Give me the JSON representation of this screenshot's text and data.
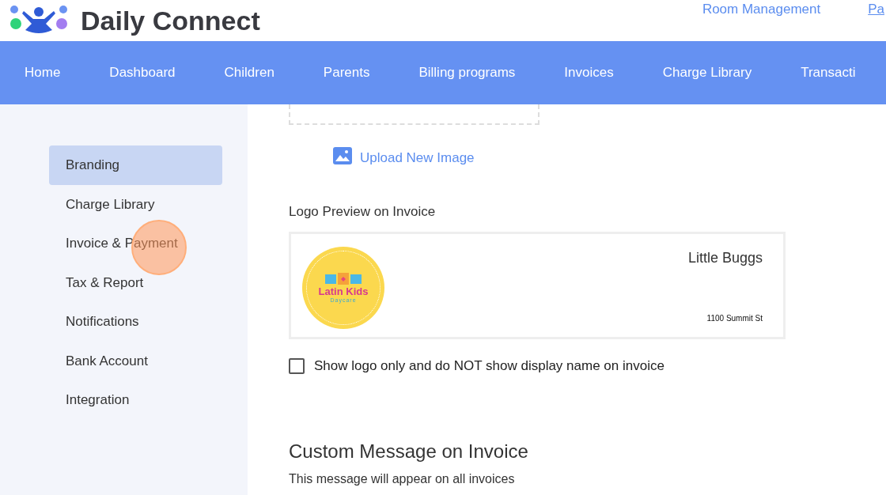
{
  "header": {
    "app_name": "Daily Connect",
    "links": [
      "Room Management",
      "Pa"
    ]
  },
  "nav": [
    "Home",
    "Dashboard",
    "Children",
    "Parents",
    "Billing programs",
    "Invoices",
    "Charge Library",
    "Transacti"
  ],
  "sidebar": {
    "items": [
      {
        "label": "Branding",
        "selected": true
      },
      {
        "label": "Charge Library",
        "selected": false
      },
      {
        "label": "Invoice & Payment",
        "selected": false
      },
      {
        "label": "Tax & Report",
        "selected": false
      },
      {
        "label": "Notifications",
        "selected": false
      },
      {
        "label": "Bank Account",
        "selected": false
      },
      {
        "label": "Integration",
        "selected": false
      }
    ]
  },
  "upload": {
    "label": "Upload New Image"
  },
  "logo_preview": {
    "heading": "Logo Preview on Invoice",
    "logo_title": "Latin Kids",
    "logo_subtitle": "Daycare",
    "display_name": "Little Buggs",
    "address": "1100 Summit St"
  },
  "logo_only": {
    "label": "Show logo only and do NOT show display name on invoice",
    "checked": false
  },
  "custom_message": {
    "heading": "Custom Message on Invoice",
    "description": "This message will appear on all invoices"
  }
}
